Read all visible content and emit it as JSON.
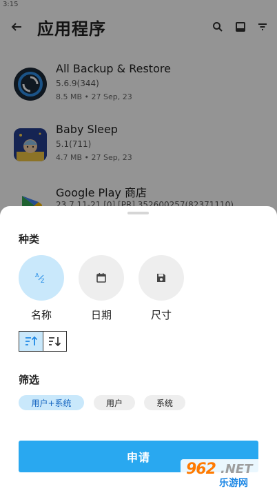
{
  "status_bar": {
    "time": "3:15"
  },
  "toolbar": {
    "title": "应用程序"
  },
  "apps": [
    {
      "name": "All Backup & Restore",
      "version": "5.6.9(344)",
      "size": "8.5 MB",
      "date": "27 Sep, 23"
    },
    {
      "name": "Baby Sleep",
      "version": "5.1(711)",
      "size": "4.7 MB",
      "date": "27 Sep, 23"
    },
    {
      "name": "Google Play 商店",
      "version": "23.7.11-21 [0] [PR] 352600257(82371110)"
    }
  ],
  "sheet": {
    "sort_title": "种类",
    "sort_options": [
      {
        "label": "名称",
        "icon": "sort-az-icon",
        "selected": true
      },
      {
        "label": "日期",
        "icon": "calendar-icon",
        "selected": false
      },
      {
        "label": "尺寸",
        "icon": "save-icon",
        "selected": false
      }
    ],
    "order_options": [
      {
        "icon": "sort-ascending-icon",
        "selected": true
      },
      {
        "icon": "sort-descending-icon",
        "selected": false
      }
    ],
    "filter_title": "筛选",
    "filter_options": [
      {
        "label": "用户+系统",
        "selected": true
      },
      {
        "label": "用户",
        "selected": false
      },
      {
        "label": "系统",
        "selected": false
      }
    ],
    "apply_label": "申请"
  },
  "watermark": {
    "number": "962",
    "suffix": ".NET",
    "site": "乐游网"
  },
  "colors": {
    "accent": "#29a8f0",
    "selected_bg": "#c9e8fb",
    "chip_bg": "#eeeeee"
  }
}
